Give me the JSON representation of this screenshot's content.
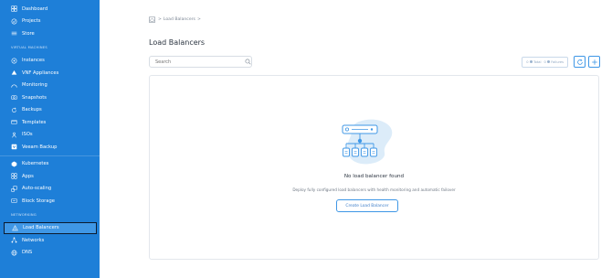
{
  "sidebar": {
    "top_items": [
      {
        "label": "Dashboard",
        "icon": "dashboard-icon"
      },
      {
        "label": "Projects",
        "icon": "projects-icon"
      },
      {
        "label": "Store",
        "icon": "store-icon"
      }
    ],
    "virtual_machines_label": "VIRTUAL MACHINES",
    "vm_items": [
      {
        "label": "Instances",
        "icon": "instances-icon"
      },
      {
        "label": "VNF Appliances",
        "icon": "vnf-icon"
      },
      {
        "label": "Monitoring",
        "icon": "monitoring-icon"
      },
      {
        "label": "Snapshots",
        "icon": "snapshots-icon"
      },
      {
        "label": "Backups",
        "icon": "backups-icon"
      },
      {
        "label": "Templates",
        "icon": "templates-icon"
      },
      {
        "label": "ISOs",
        "icon": "isos-icon"
      },
      {
        "label": "Veeam Backup",
        "icon": "veeam-icon"
      }
    ],
    "other_items": [
      {
        "label": "Kubernetes",
        "icon": "kubernetes-icon"
      },
      {
        "label": "Apps",
        "icon": "apps-icon"
      },
      {
        "label": "Auto-scaling",
        "icon": "autoscaling-icon"
      },
      {
        "label": "Block Storage",
        "icon": "block-storage-icon"
      }
    ],
    "networking_label": "NETWORKING",
    "net_items": [
      {
        "label": "Load Balancers",
        "icon": "load-balancer-icon",
        "active": true
      },
      {
        "label": "Networks",
        "icon": "networks-icon"
      },
      {
        "label": "DNS",
        "icon": "dns-icon"
      }
    ]
  },
  "breadcrumb": {
    "sep1": ">",
    "current": "Load Balancers",
    "sep2": ">"
  },
  "page_title": "Load Balancers",
  "search": {
    "placeholder": "Search"
  },
  "toolbar": {
    "chip_count_1": "0",
    "chip_label_1": "Total",
    "chip_count_2": "0",
    "chip_label_2": "Failures"
  },
  "empty_state": {
    "title": "No load balancer found",
    "description": "Deploy fully configured load balancers with health monitoring and automatic failover",
    "button_label": "Create Load Balancer"
  },
  "colors": {
    "sidebar_bg": "#1e7fd8",
    "accent": "#3f97e6",
    "illustration_blob": "#dcecf9"
  }
}
